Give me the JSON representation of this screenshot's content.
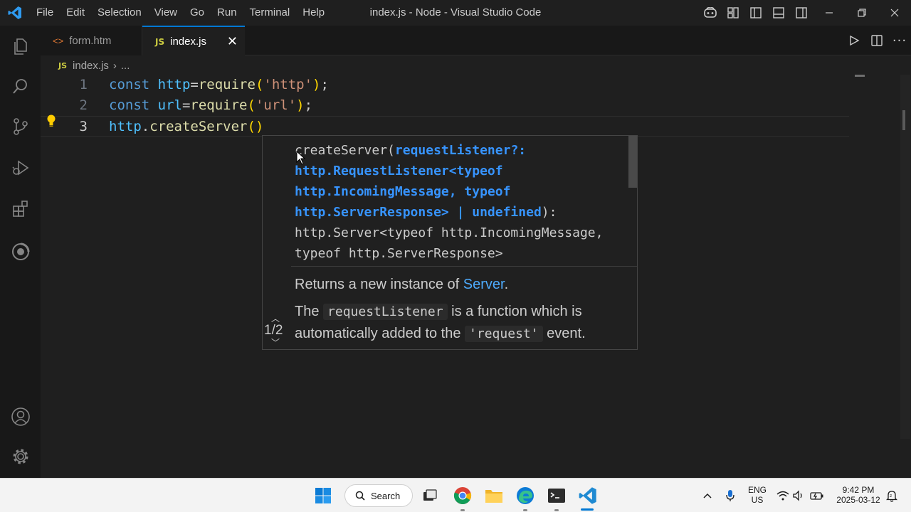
{
  "titlebar": {
    "menu": [
      "File",
      "Edit",
      "Selection",
      "View",
      "Go",
      "Run",
      "Terminal",
      "Help"
    ],
    "window_title": "index.js - Node - Visual Studio Code"
  },
  "tabs": [
    {
      "label": "form.htm",
      "active": false
    },
    {
      "label": "index.js",
      "active": true
    }
  ],
  "breadcrumb": {
    "file": "index.js",
    "more": "..."
  },
  "editor": {
    "lines": [
      {
        "num": "1",
        "tokens": [
          [
            "kw",
            "const "
          ],
          [
            "var",
            "http"
          ],
          [
            "plain",
            "="
          ],
          [
            "fn",
            "require"
          ],
          [
            "br",
            "("
          ],
          [
            "str",
            "'http'"
          ],
          [
            "br",
            ")"
          ],
          [
            "plain",
            ";"
          ]
        ]
      },
      {
        "num": "2",
        "tokens": [
          [
            "kw",
            "const "
          ],
          [
            "var",
            "url"
          ],
          [
            "plain",
            "="
          ],
          [
            "fn",
            "require"
          ],
          [
            "br",
            "("
          ],
          [
            "str",
            "'url'"
          ],
          [
            "br",
            ")"
          ],
          [
            "plain",
            ";"
          ]
        ]
      },
      {
        "num": "3",
        "tokens": [
          [
            "var",
            "http"
          ],
          [
            "plain",
            "."
          ],
          [
            "fn",
            "createServer"
          ],
          [
            "br",
            "()"
          ]
        ]
      }
    ]
  },
  "signature_help": {
    "counter": "1/2",
    "sig_prefix": "createServer(",
    "sig_param": "requestListener?: http.RequestListener<typeof http.IncomingMessage, typeof http.ServerResponse> | undefined",
    "sig_suffix": "): http.Server<typeof http.IncomingMessage, typeof http.ServerResponse>",
    "doc1_prefix": "Returns a new instance of ",
    "doc1_link": "Server",
    "doc1_suffix": ".",
    "doc2_a": "The ",
    "doc2_code1": "requestListener",
    "doc2_b": " is a function which is automatically added to the ",
    "doc2_code2": "'request'",
    "doc2_c": " event."
  },
  "taskbar": {
    "search_label": "Search",
    "lang_top": "ENG",
    "lang_bottom": "US",
    "time": "9:42 PM",
    "date": "2025-03-12"
  },
  "colors": {
    "accent": "#0078d4",
    "keyword": "#569cd6",
    "variable": "#4fc1ff",
    "function": "#dcdcaa",
    "string": "#ce9178",
    "param": "#3794ff"
  }
}
